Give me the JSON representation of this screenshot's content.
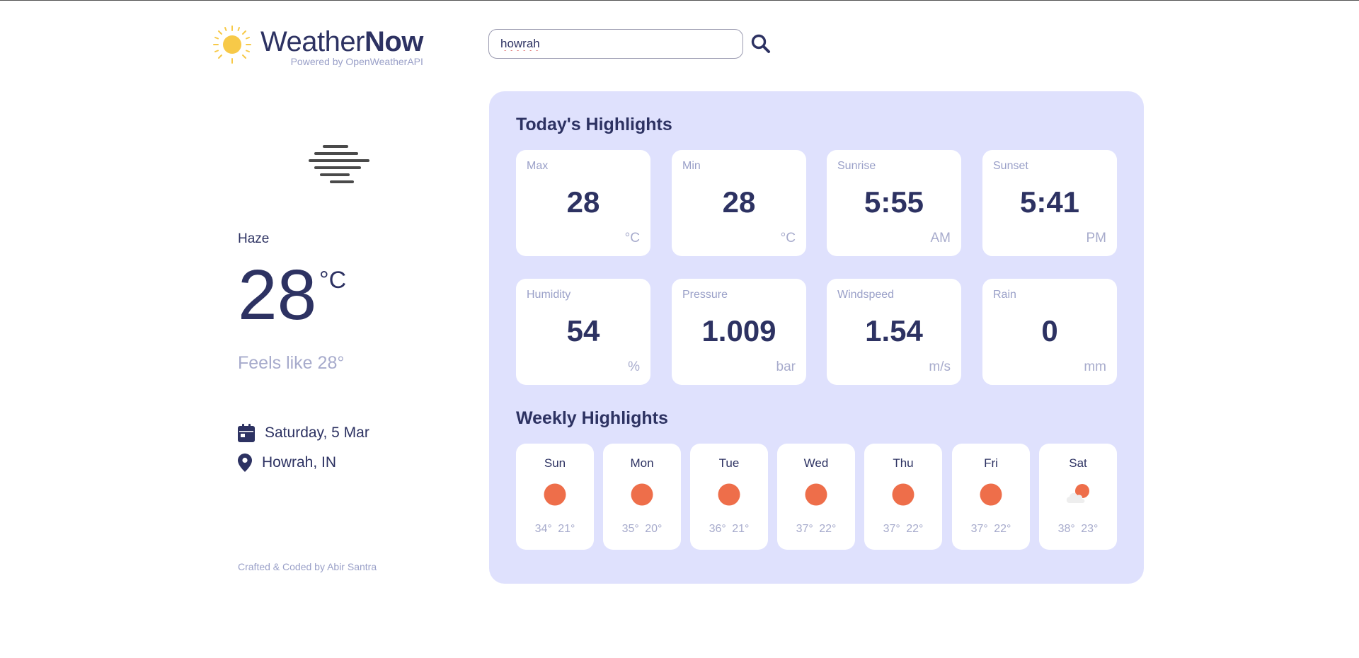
{
  "brand": {
    "title_light": "Weather",
    "title_bold": "Now",
    "subtitle": "Powered by OpenWeatherAPI"
  },
  "search": {
    "value": "howrah"
  },
  "current": {
    "condition": "Haze",
    "temp": "28",
    "unit": "°C",
    "feels_like": "Feels like 28°",
    "date": "Saturday, 5 Mar",
    "location": "Howrah, IN"
  },
  "footer": {
    "credit": "Crafted & Coded by Abir Santra"
  },
  "today": {
    "title": "Today's Highlights",
    "cards": [
      {
        "label": "Max",
        "value": "28",
        "unit": "°C"
      },
      {
        "label": "Min",
        "value": "28",
        "unit": "°C"
      },
      {
        "label": "Sunrise",
        "value": "5:55",
        "unit": "AM"
      },
      {
        "label": "Sunset",
        "value": "5:41",
        "unit": "PM"
      },
      {
        "label": "Humidity",
        "value": "54",
        "unit": "%"
      },
      {
        "label": "Pressure",
        "value": "1.009",
        "unit": "bar"
      },
      {
        "label": "Windspeed",
        "value": "1.54",
        "unit": "m/s"
      },
      {
        "label": "Rain",
        "value": "0",
        "unit": "mm"
      }
    ]
  },
  "weekly": {
    "title": "Weekly Highlights",
    "days": [
      {
        "name": "Sun",
        "icon": "sun-icon",
        "temps": "34° 21°"
      },
      {
        "name": "Mon",
        "icon": "sun-icon",
        "temps": "35° 20°"
      },
      {
        "name": "Tue",
        "icon": "sun-icon",
        "temps": "36° 21°"
      },
      {
        "name": "Wed",
        "icon": "sun-icon",
        "temps": "37° 22°"
      },
      {
        "name": "Thu",
        "icon": "sun-icon",
        "temps": "37° 22°"
      },
      {
        "name": "Fri",
        "icon": "sun-icon",
        "temps": "37° 22°"
      },
      {
        "name": "Sat",
        "icon": "partly-cloudy-icon",
        "temps": "38° 23°"
      }
    ]
  },
  "colors": {
    "accent": "#2d3262",
    "panel": "#dfe1fd",
    "sun": "#ee6e4a",
    "muted": "#a7abcc"
  }
}
